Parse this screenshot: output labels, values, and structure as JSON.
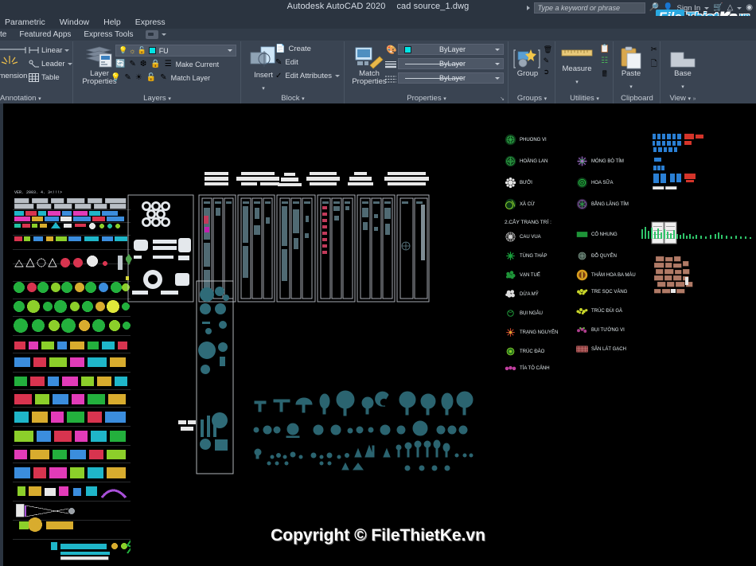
{
  "titlebar": {
    "app_title": "Autodesk AutoCAD 2020",
    "file_name": "cad source_1.dwg",
    "search_placeholder": "Type a keyword or phrase",
    "sign_in": "Sign In",
    "icons": [
      "search-icon",
      "user-icon",
      "cart-icon",
      "help-triangle-icon",
      "globe-icon"
    ]
  },
  "brand_watermark": {
    "part1": "File",
    "part2": "Thiet",
    "part3": "Ke",
    "part4": ".vn"
  },
  "menubar": {
    "items": [
      {
        "label": "Parametric"
      },
      {
        "label": "Window"
      },
      {
        "label": "Help"
      },
      {
        "label": "Express"
      }
    ]
  },
  "tabrow": {
    "tabs": [
      {
        "label": "te"
      },
      {
        "label": "Featured Apps"
      },
      {
        "label": "Express Tools"
      }
    ],
    "quick_button": "view-dropdown-button"
  },
  "ribbon": {
    "panels": [
      {
        "name": "annotation",
        "title": "Annotation",
        "big_label": "Dimension",
        "items": [
          {
            "label": "Linear",
            "icon": "linear-dimension-icon",
            "has_dropdown": true
          },
          {
            "label": "Leader",
            "icon": "leader-icon",
            "has_dropdown": true
          },
          {
            "label": "Table",
            "icon": "table-icon",
            "has_dropdown": false
          }
        ]
      },
      {
        "name": "layers",
        "title": "Layers",
        "big_label": "Layer\nProperties",
        "big_label_line1": "Layer",
        "big_label_line2": "Properties",
        "layer_name": "FU",
        "layer_color": "#00e5e5",
        "items": [
          {
            "label": "Make Current",
            "icon": "make-current-layer-icon"
          },
          {
            "label": "Match Layer",
            "icon": "match-layer-icon"
          }
        ]
      },
      {
        "name": "block",
        "title": "Block",
        "big_label": "Insert",
        "items": [
          {
            "label": "Create",
            "icon": "create-block-icon"
          },
          {
            "label": "Edit",
            "icon": "edit-block-icon"
          },
          {
            "label": "Edit Attributes",
            "icon": "edit-attributes-icon",
            "has_dropdown": true
          }
        ]
      },
      {
        "name": "properties",
        "title": "Properties",
        "big_label_line1": "Match",
        "big_label_line2": "Properties",
        "dropdowns": [
          {
            "value": "ByLayer",
            "icon": "color-wheel-icon",
            "kind": "color"
          },
          {
            "value": "ByLayer",
            "icon": "linewidth-icon",
            "kind": "lineweight"
          },
          {
            "value": "ByLayer",
            "icon": "linetype-icon",
            "kind": "linetype"
          }
        ]
      },
      {
        "name": "groups",
        "title": "Groups",
        "big_label": "Group"
      },
      {
        "name": "utilities",
        "title": "Utilities",
        "big_label": "Measure"
      },
      {
        "name": "clipboard",
        "title": "Clipboard",
        "big_label": "Paste"
      },
      {
        "name": "view",
        "title": "View",
        "big_label": "Base"
      }
    ]
  },
  "drawing": {
    "left_library_note": "VER. 2003. 4. 3<!!!>",
    "legend": {
      "section_heading": "2.CÂY TRANG TRÍ :",
      "trees_col_left": [
        {
          "label": "PHUONG VI",
          "color": "#1f8a3a",
          "shape": "circle-cluster"
        },
        {
          "label": "HOÀNG LAN",
          "color": "#1f8a3a",
          "shape": "circle-cluster"
        },
        {
          "label": "BƯỞI",
          "color": "#e8e8e8",
          "shape": "circle-cluster"
        },
        {
          "label": "XÀ CỪ",
          "color": "#8ccf2a",
          "shape": "circle-cluster"
        }
      ],
      "trees_col_right": [
        {
          "label": "MÓNG BÒ TÍM",
          "color": "#9b6fc0",
          "shape": "circle-cluster"
        },
        {
          "label": "HOA SỮA",
          "color": "#26d04a",
          "shape": "circle-cluster"
        },
        {
          "label": "BẰNG LĂNG TÍM",
          "color": "#8f5fae",
          "shape": "circle-cluster"
        }
      ],
      "shrubs_col_left": [
        {
          "label": "CAU VUA",
          "color": "#d8d8d8",
          "shape": "starburst"
        },
        {
          "label": "TÙNG THÁP",
          "color": "#19a03c",
          "shape": "star"
        },
        {
          "label": "VẠN TUẾ",
          "color": "#1e9438",
          "shape": "cluster"
        },
        {
          "label": "DỪA MỸ",
          "color": "#dcdcdc",
          "shape": "cluster"
        },
        {
          "label": "BỤI NGÂU",
          "color": "#1e9438",
          "shape": "small-circle"
        },
        {
          "label": "TRẠNG NGUYÊN",
          "color": "#c2452b",
          "shape": "star"
        },
        {
          "label": "TRÚC ĐÀO",
          "color": "#8ccf2a",
          "shape": "circle"
        },
        {
          "label": "TÍA TÔ CẢNH",
          "color": "#c23fa0",
          "shape": "cluster"
        }
      ],
      "shrubs_col_right": [
        {
          "label": "CỎ NHUNG",
          "color": "#1e9438",
          "shape": "square"
        },
        {
          "label": "ĐỖ QUYÊN",
          "color": "#7f9a8a",
          "shape": "circle"
        },
        {
          "label": "THẢM HOA BA MÀU",
          "color": "#d79d1e",
          "shape": "circle"
        },
        {
          "label": "TRE SỌC VÀNG",
          "color": "#c9d62a",
          "shape": "cluster"
        },
        {
          "label": "TRÚC ĐÙI GÀ",
          "color": "#c9d62a",
          "shape": "cluster"
        },
        {
          "label": "BỤI TƯỜNG VI",
          "color": "#b03f8e",
          "shape": "cluster"
        },
        {
          "label": "SÂN LÁT GẠCH",
          "color": "#c96a6a",
          "shape": "square-hatch"
        }
      ]
    },
    "copyright": "Copyright © FileThietKe.vn"
  }
}
